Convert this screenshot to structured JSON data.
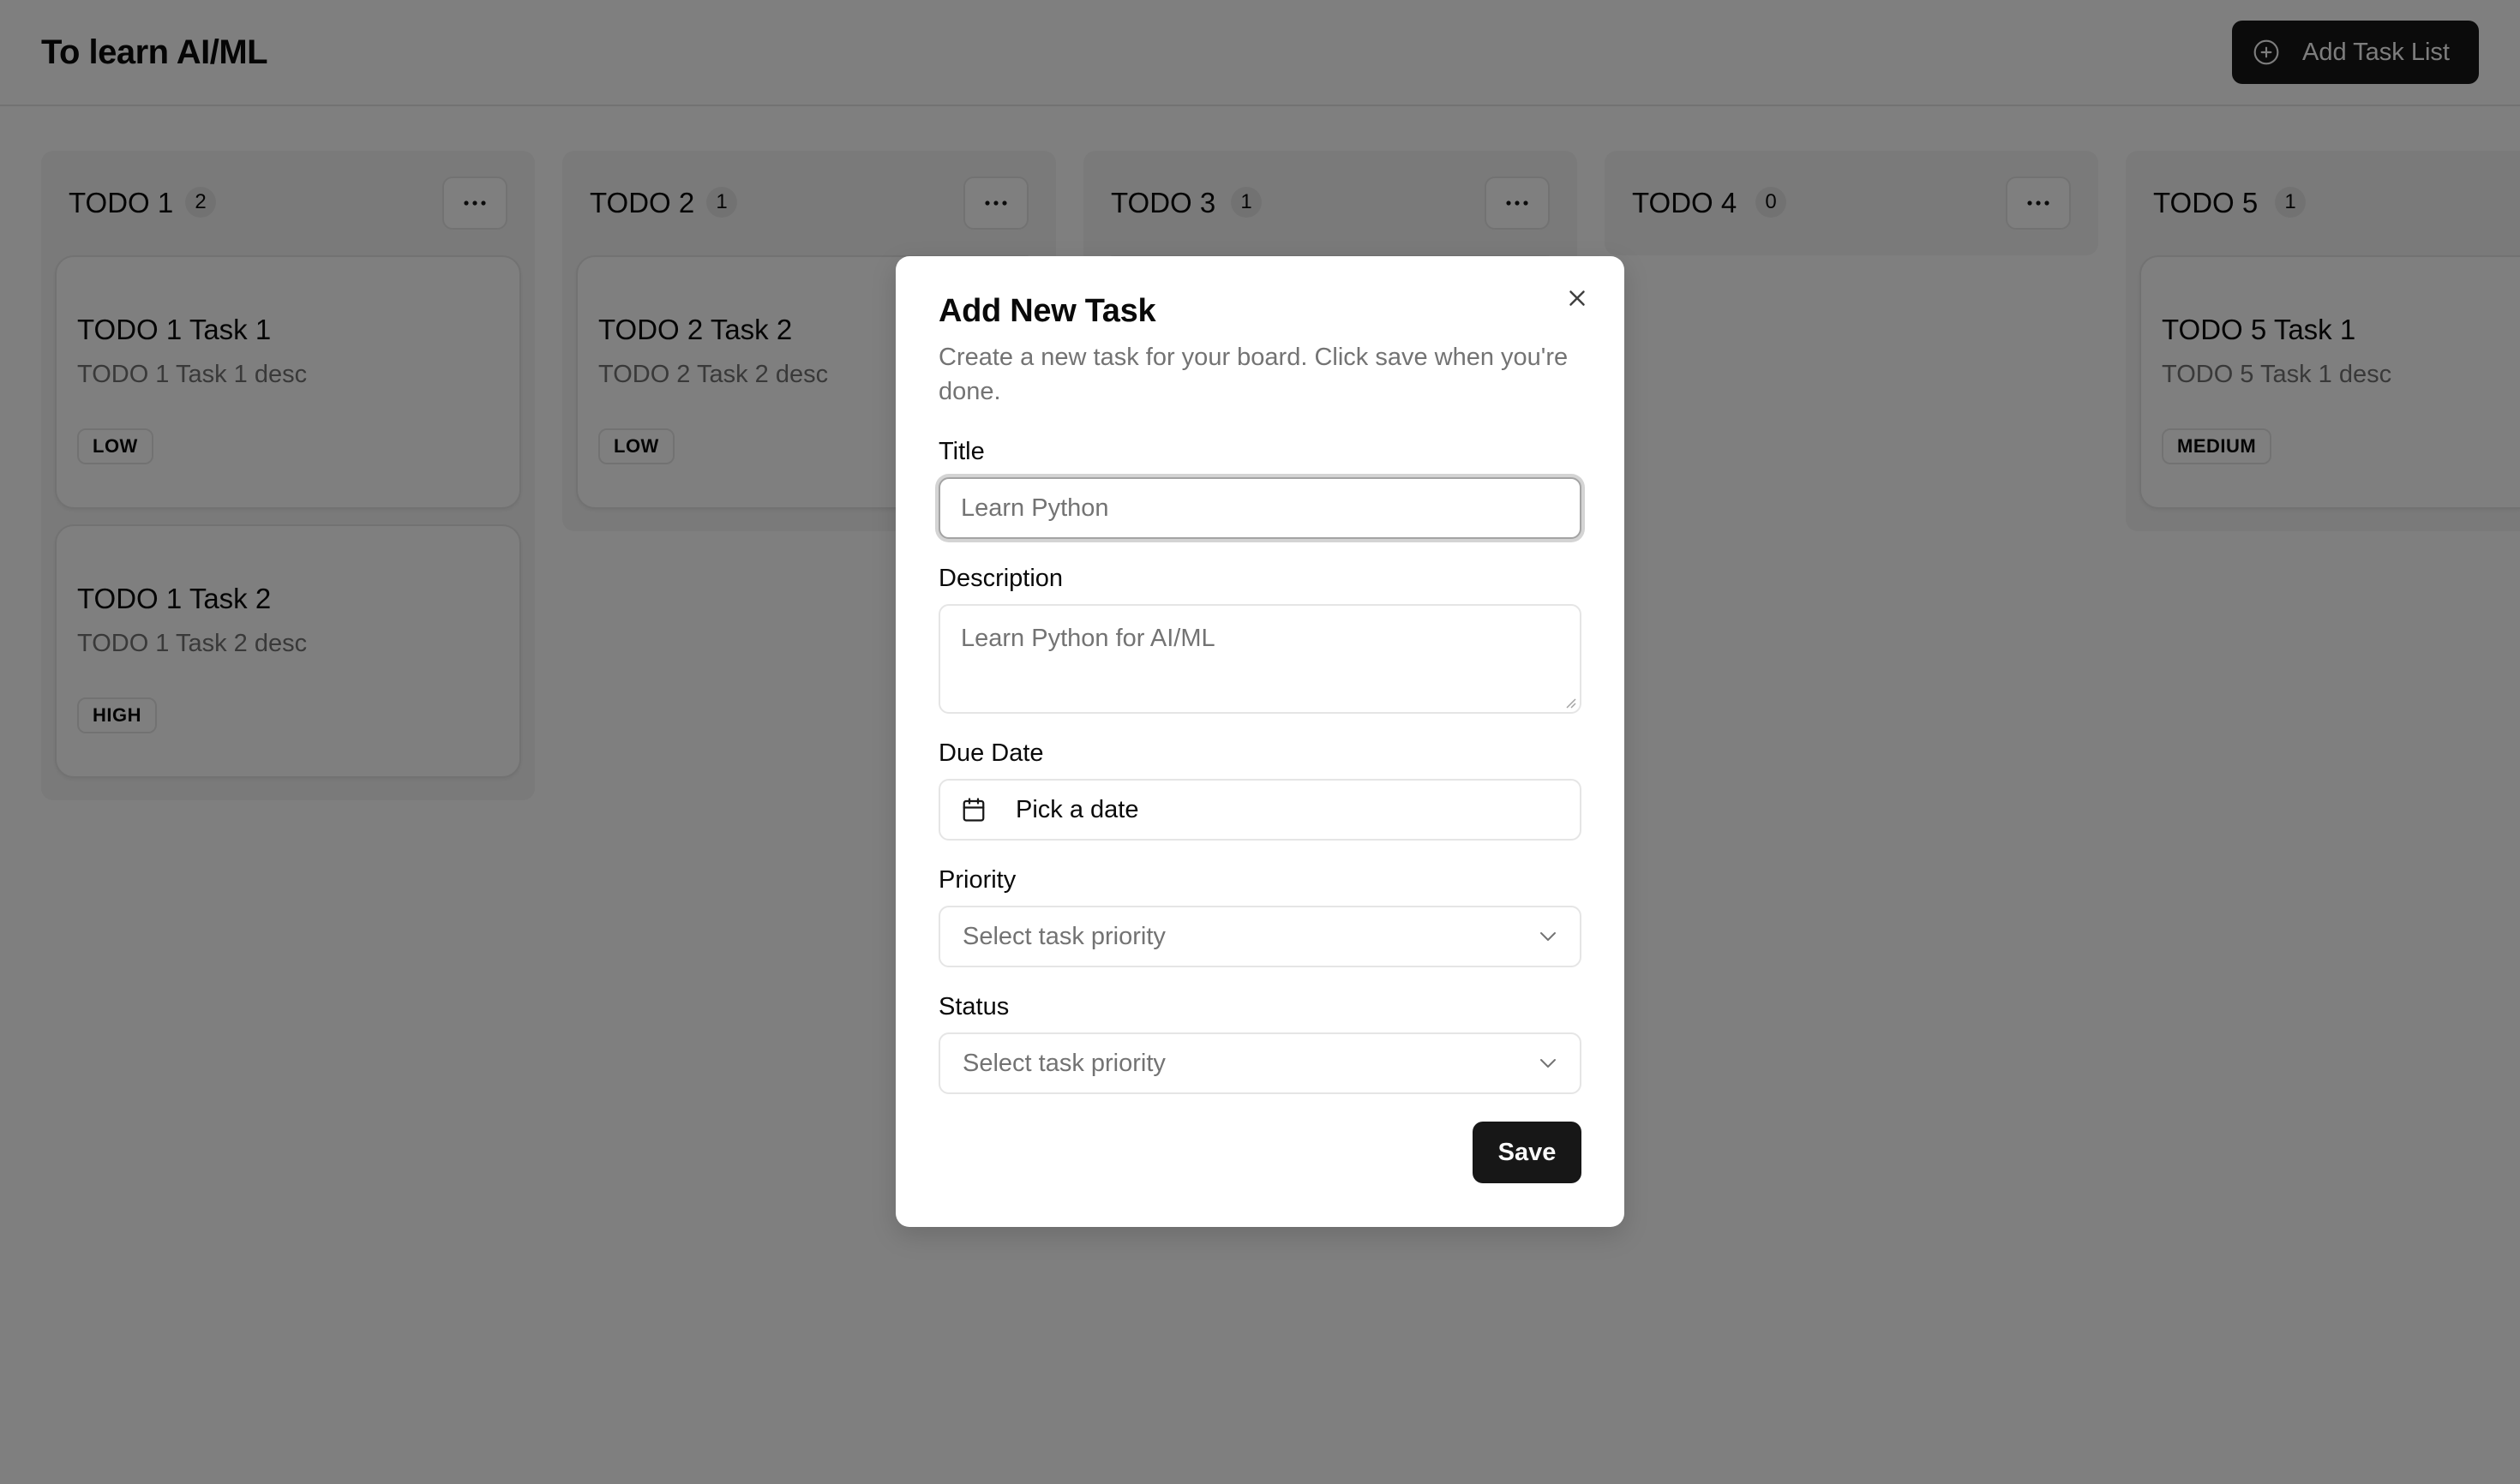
{
  "header": {
    "title": "To learn AI/ML",
    "add_list_label": "Add Task List"
  },
  "board": {
    "columns": [
      {
        "title": "TODO 1",
        "count": "2",
        "tasks": [
          {
            "title": "TODO 1 Task 1",
            "desc": "TODO 1 Task 1 desc",
            "priority": "LOW"
          },
          {
            "title": "TODO 1 Task 2",
            "desc": "TODO 1 Task 2 desc",
            "priority": "HIGH"
          }
        ]
      },
      {
        "title": "TODO 2",
        "count": "1",
        "tasks": [
          {
            "title": "TODO 2 Task 2",
            "desc": "TODO 2 Task 2 desc",
            "priority": "LOW"
          }
        ]
      },
      {
        "title": "TODO 3",
        "count": "1",
        "tasks": []
      },
      {
        "title": "TODO 4",
        "count": "0",
        "tasks": []
      },
      {
        "title": "TODO 5",
        "count": "1",
        "tasks": [
          {
            "title": "TODO 5 Task 1",
            "desc": "TODO 5 Task 1 desc",
            "priority": "MEDIUM"
          }
        ]
      }
    ]
  },
  "dialog": {
    "title": "Add New Task",
    "description": "Create a new task for your board. Click save when you're done.",
    "title_label": "Title",
    "title_placeholder": "Learn Python",
    "description_label": "Description",
    "description_placeholder": "Learn Python for AI/ML",
    "due_date_label": "Due Date",
    "due_date_placeholder": "Pick a date",
    "priority_label": "Priority",
    "priority_placeholder": "Select task priority",
    "status_label": "Status",
    "status_placeholder": "Select task priority",
    "save_label": "Save"
  },
  "icons": {
    "add": "plus-circle-icon",
    "more": "more-horizontal-icon",
    "close": "close-icon",
    "calendar": "calendar-icon",
    "chevron": "chevron-down-icon"
  },
  "colors": {
    "primary": "#171717",
    "primary_text": "#fafafa",
    "muted_text": "#737373",
    "border": "#e5e5e5",
    "column_bg": "#f5f5f5",
    "overlay": "rgba(0,0,0,0.5)"
  }
}
